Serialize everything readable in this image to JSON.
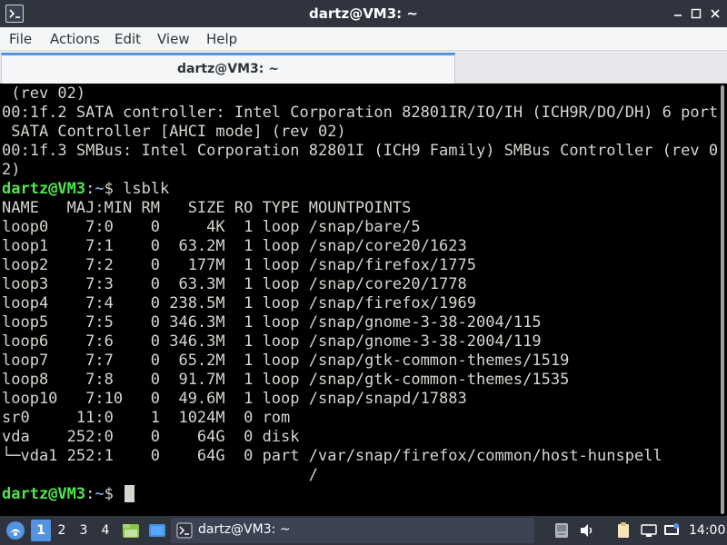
{
  "window": {
    "title": "dartz@VM3: ~"
  },
  "menubar": {
    "items": [
      "File",
      "Actions",
      "Edit",
      "View",
      "Help"
    ]
  },
  "tab": {
    "label": "dartz@VM3: ~"
  },
  "terminal": {
    "lines": [
      " (rev 02)",
      "00:1f.2 SATA controller: Intel Corporation 82801IR/IO/IH (ICH9R/DO/DH) 6 port",
      " SATA Controller [AHCI mode] (rev 02)",
      "00:1f.3 SMBus: Intel Corporation 82801I (ICH9 Family) SMBus Controller (rev 0",
      "2)"
    ],
    "prompt": {
      "user": "dartz@VM3",
      "sep": ":",
      "path": "~",
      "symbol": "$ "
    },
    "command": "lsblk",
    "table_header": "NAME   MAJ:MIN RM   SIZE RO TYPE MOUNTPOINTS",
    "table_rows": [
      "loop0    7:0    0     4K  1 loop /snap/bare/5",
      "loop1    7:1    0  63.2M  1 loop /snap/core20/1623",
      "loop2    7:2    0   177M  1 loop /snap/firefox/1775",
      "loop3    7:3    0  63.3M  1 loop /snap/core20/1778",
      "loop4    7:4    0 238.5M  1 loop /snap/firefox/1969",
      "loop5    7:5    0 346.3M  1 loop /snap/gnome-3-38-2004/115",
      "loop6    7:6    0 346.3M  1 loop /snap/gnome-3-38-2004/119",
      "loop7    7:7    0  65.2M  1 loop /snap/gtk-common-themes/1519",
      "loop8    7:8    0  91.7M  1 loop /snap/gtk-common-themes/1535",
      "loop10   7:10   0  49.6M  1 loop /snap/snapd/17883",
      "sr0     11:0    1  1024M  0 rom",
      "vda    252:0    0    64G  0 disk",
      "└─vda1 252:1    0    64G  0 part /var/snap/firefox/common/host-hunspell",
      "                                 /"
    ]
  },
  "taskbar": {
    "workspaces": [
      "1",
      "2",
      "3",
      "4"
    ],
    "task_label": "dartz@VM3: ~",
    "clock": "14:00",
    "icons": {
      "menu": "start-menu-icon",
      "files": "file-manager-icon",
      "desktop": "show-desktop-icon",
      "task": "terminal-icon",
      "tray": [
        "updates-icon",
        "volume-icon",
        "clipboard-icon",
        "network-icon",
        "display-icon"
      ]
    }
  },
  "colors": {
    "accent": "#5294e2",
    "prompt_user": "#4ee64e",
    "prompt_path": "#729fcf",
    "terminal_text": "#d3d7cf"
  }
}
